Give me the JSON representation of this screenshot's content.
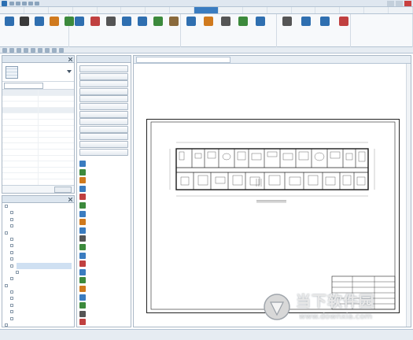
{
  "window": {
    "title": ""
  },
  "ribbon_tabs": [
    "",
    "",
    "",
    "",
    "",
    "",
    "",
    "",
    "",
    "",
    "",
    "",
    "",
    "",
    "",
    "",
    ""
  ],
  "active_tab_index": 8,
  "ribbon": {
    "tools": [
      {
        "label": "",
        "icon": "template-icon",
        "color": "#2f6fb0"
      },
      {
        "label": "",
        "icon": "text-icon",
        "color": "#3a3a3a"
      },
      {
        "label": "",
        "icon": "text-replace-icon",
        "color": "#2f6fb0"
      },
      {
        "label": "",
        "icon": "dimension-icon",
        "color": "#d07a1e"
      },
      {
        "label": "",
        "icon": "elevation-icon",
        "color": "#3c8a3c"
      },
      {
        "label": "",
        "icon": "table-icon",
        "color": "#2f6fb0"
      },
      {
        "label": "",
        "icon": "color-icon",
        "color": "#c04040"
      },
      {
        "label": "",
        "icon": "print-icon",
        "color": "#555555"
      },
      {
        "label": "",
        "icon": "layout-icon",
        "color": "#2f6fb0"
      },
      {
        "label": "",
        "icon": "sheet-icon",
        "color": "#2f6fb0"
      },
      {
        "label": "",
        "icon": "window-icon",
        "color": "#3c8a3c"
      },
      {
        "label": "",
        "icon": "door-icon",
        "color": "#8a6a3c"
      },
      {
        "label": "",
        "icon": "room-icon",
        "color": "#2f6fb0"
      },
      {
        "label": "",
        "icon": "tag-icon",
        "color": "#d07a1e"
      },
      {
        "label": "",
        "icon": "stair-icon",
        "color": "#555555"
      },
      {
        "label": "",
        "icon": "area-icon",
        "color": "#3c8a3c"
      },
      {
        "label": "",
        "icon": "wall-icon",
        "color": "#2f6fb0"
      },
      {
        "label": "",
        "icon": "settings-icon",
        "color": "#555555"
      },
      {
        "label": "",
        "icon": "help-icon",
        "color": "#2f6fb0"
      },
      {
        "label": "",
        "icon": "info-icon",
        "color": "#2f6fb0"
      },
      {
        "label": "",
        "icon": "version-icon",
        "color": "#c04040"
      }
    ],
    "groups": [
      "",
      "",
      "",
      "",
      ""
    ]
  },
  "properties": {
    "header": "",
    "type_name": "",
    "filter_value": "",
    "edit_type": "",
    "rows": [
      {
        "k": "",
        "v": "",
        "cat": true
      },
      {
        "k": "",
        "v": ""
      },
      {
        "k": "",
        "v": ""
      },
      {
        "k": "",
        "v": "",
        "cat": true
      },
      {
        "k": "",
        "v": ""
      },
      {
        "k": "",
        "v": ""
      },
      {
        "k": "",
        "v": ""
      },
      {
        "k": "",
        "v": ""
      },
      {
        "k": "",
        "v": ""
      },
      {
        "k": "",
        "v": ""
      },
      {
        "k": "",
        "v": ""
      },
      {
        "k": "",
        "v": ""
      },
      {
        "k": "",
        "v": ""
      },
      {
        "k": "",
        "v": ""
      },
      {
        "k": "",
        "v": ""
      },
      {
        "k": "",
        "v": ""
      }
    ],
    "help_link": "",
    "apply": ""
  },
  "browser": {
    "header": "",
    "nodes": [
      {
        "t": "",
        "lvl": 1
      },
      {
        "t": "",
        "lvl": 2
      },
      {
        "t": "",
        "lvl": 2
      },
      {
        "t": "",
        "lvl": 2
      },
      {
        "t": "",
        "lvl": 1
      },
      {
        "t": "",
        "lvl": 2
      },
      {
        "t": "",
        "lvl": 2
      },
      {
        "t": "",
        "lvl": 2
      },
      {
        "t": "",
        "lvl": 2
      },
      {
        "t": "",
        "lvl": 2,
        "sel": true
      },
      {
        "t": "",
        "lvl": 3
      },
      {
        "t": "",
        "lvl": 2
      },
      {
        "t": "",
        "lvl": 1
      },
      {
        "t": "",
        "lvl": 2
      },
      {
        "t": "",
        "lvl": 2
      },
      {
        "t": "",
        "lvl": 2
      },
      {
        "t": "",
        "lvl": 2
      },
      {
        "t": "",
        "lvl": 2
      },
      {
        "t": "",
        "lvl": 1
      },
      {
        "t": "",
        "lvl": 1
      }
    ]
  },
  "families": {
    "header": "",
    "buttons": [
      "",
      "",
      "",
      "",
      "",
      "",
      "",
      "",
      "",
      "",
      "",
      ""
    ],
    "items": [
      {
        "t": "",
        "icon": "place-icon",
        "color": "#3a7cc0"
      },
      {
        "t": "",
        "icon": "insert-icon",
        "color": "#3c8a3c"
      },
      {
        "t": "",
        "icon": "arrange-icon",
        "color": "#d07a1e"
      },
      {
        "t": "",
        "icon": "replace-icon",
        "color": "#3a7cc0"
      },
      {
        "t": "",
        "icon": "create-icon",
        "color": "#c04040"
      },
      {
        "t": "",
        "icon": "design-icon",
        "color": "#3c8a3c"
      },
      {
        "t": "",
        "icon": "dimension-icon",
        "color": "#3a7cc0"
      },
      {
        "t": "",
        "icon": "check-icon",
        "color": "#d07a1e"
      },
      {
        "t": "",
        "icon": "stats-icon",
        "color": "#3a7cc0"
      },
      {
        "t": "",
        "icon": "select-icon",
        "color": "#555555"
      },
      {
        "t": "",
        "icon": "report-icon",
        "color": "#3c8a3c"
      },
      {
        "t": "",
        "icon": "list-icon",
        "color": "#3a7cc0"
      },
      {
        "t": "",
        "icon": "tools-icon",
        "color": "#c04040"
      },
      {
        "t": "",
        "icon": "search-icon",
        "color": "#3a7cc0"
      },
      {
        "t": "",
        "icon": "update-icon",
        "color": "#3c8a3c"
      },
      {
        "t": "",
        "icon": "export-icon",
        "color": "#d07a1e"
      },
      {
        "t": "",
        "icon": "table-icon",
        "color": "#3a7cc0"
      },
      {
        "t": "",
        "icon": "sync-icon",
        "color": "#3c8a3c"
      },
      {
        "t": "",
        "icon": "settings-icon",
        "color": "#555555"
      },
      {
        "t": "",
        "icon": "exit-icon",
        "color": "#c04040"
      }
    ]
  },
  "view": {
    "tab_title": ""
  },
  "status": {
    "text": ""
  },
  "watermark": {
    "brand": "当下软件园",
    "url": "www.downxia.com"
  }
}
